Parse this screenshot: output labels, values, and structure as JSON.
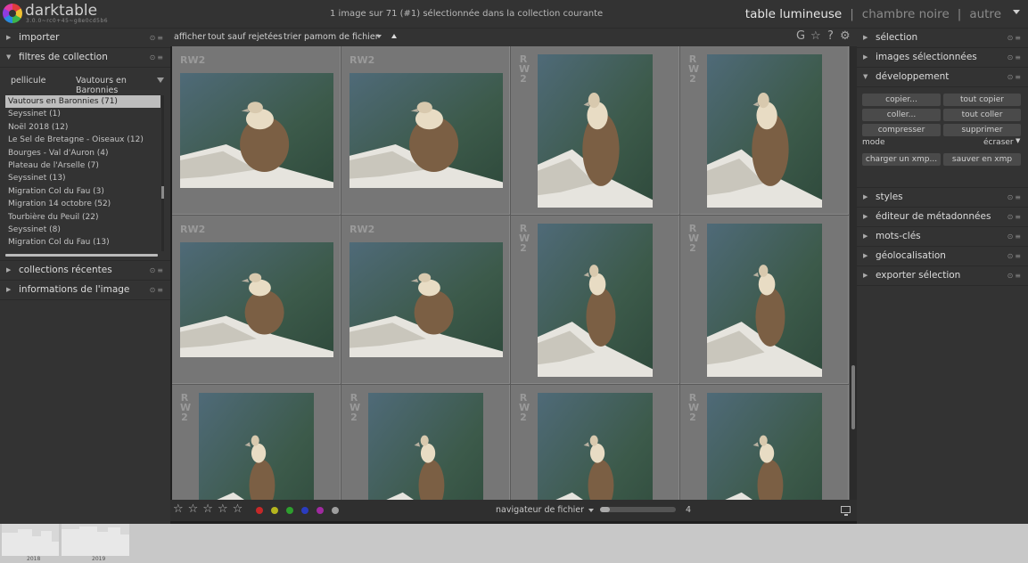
{
  "topbar": {
    "app_name": "darktable",
    "app_version": "3.0.0~rc0+45~g8e0cd5b6",
    "status": "1 image sur 71 (#1) sélectionnée dans la collection courante",
    "views": [
      "table lumineuse",
      "chambre noire",
      "autre"
    ],
    "views_sep": "|"
  },
  "left_panel": {
    "importer": "importer",
    "collection_filters": "filtres de collection",
    "collection_property": "pellicule",
    "collection_value": "Vautours en Baronnies",
    "film_rolls": [
      "Vautours en Baronnies (71)",
      "Seyssinet (1)",
      "Noël 2018 (12)",
      "Le Sel de Bretagne - Oiseaux (12)",
      "Bourges - Val d'Auron (4)",
      "Plateau de l'Arselle (7)",
      "Seyssinet (13)",
      "Migration Col du Fau (3)",
      "Migration 14 octobre (52)",
      "Tourbière du Peuil (22)",
      "Seyssinet (8)",
      "Migration Col du Fau (13)"
    ],
    "recent_collections": "collections récentes",
    "image_information": "informations de l'image",
    "icons": {
      "expanded": "triangle-down-icon",
      "collapsed": "triangle-right-icon",
      "reset": "reset-icon",
      "presets": "presets-icon"
    }
  },
  "filterbar": {
    "show_label": "afficher",
    "show_value": "tout sauf rejetées",
    "sort_label": "trier par",
    "sort_value": "nom de fichier",
    "icons": [
      "grouping-icon",
      "star-icon",
      "help-icon",
      "gear-icon"
    ],
    "grouping_glyph": "G",
    "help_glyph": "?"
  },
  "lighttable": {
    "columns": 4,
    "thumbnails": [
      {
        "ext": "RW2",
        "orientation": "landscape"
      },
      {
        "ext": "RW2",
        "orientation": "landscape"
      },
      {
        "ext": "RW2",
        "orientation": "portrait"
      },
      {
        "ext": "RW2",
        "orientation": "portrait"
      },
      {
        "ext": "RW2",
        "orientation": "landscape"
      },
      {
        "ext": "RW2",
        "orientation": "landscape"
      },
      {
        "ext": "RW2",
        "orientation": "portrait"
      },
      {
        "ext": "RW2",
        "orientation": "portrait"
      },
      {
        "ext": "RW2",
        "orientation": "portrait"
      },
      {
        "ext": "RW2",
        "orientation": "portrait"
      },
      {
        "ext": "RW2",
        "orientation": "portrait"
      },
      {
        "ext": "RW2",
        "orientation": "portrait"
      }
    ]
  },
  "bottombar": {
    "stars": "☆☆☆☆☆",
    "color_labels": [
      "#c62828",
      "#b5b51e",
      "#2e9e2e",
      "#2a3cbf",
      "#a02aa0",
      "#9e9e9e"
    ],
    "navigator": "navigateur de fichier",
    "zoom_value": "4",
    "zoom_fraction": 0.13,
    "display_icon": "display-icon"
  },
  "right_panel": {
    "modules": {
      "selection": "sélection",
      "selected_images": "images sélectionnées",
      "development": "développement",
      "styles": "styles",
      "metadata_editor": "éditeur de métadonnées",
      "tags": "mots-clés",
      "geolocation": "géolocalisation",
      "export": "exporter sélection"
    },
    "development_buttons": {
      "copy": "copier...",
      "copy_all": "tout copier",
      "paste": "coller...",
      "paste_all": "tout coller",
      "compress": "compresser",
      "delete": "supprimer",
      "mode_label": "mode",
      "mode_value": "écraser",
      "load_xmp": "charger un xmp...",
      "save_xmp": "sauver en xmp"
    }
  },
  "timeline": {
    "years": [
      "2018",
      "2019"
    ]
  }
}
